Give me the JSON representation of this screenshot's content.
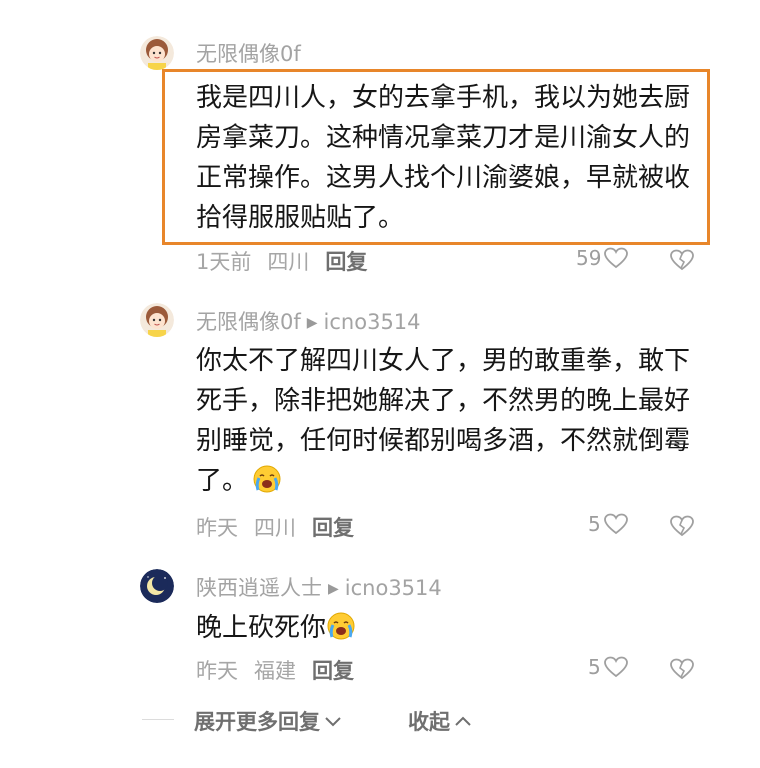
{
  "comments": [
    {
      "username": "无限偶像0f",
      "reply_to": "",
      "text": "我是四川人，女的去拿手机，我以为她去厨房拿菜刀。这种情况拿菜刀才是川渝女人的正常操作。这男人找个川渝婆娘，早就被收拾得服服贴贴了。",
      "time": "1天前",
      "location": "四川",
      "reply_label": "回复",
      "likes": "59",
      "avatar_icon": "cartoon-girl-avatar"
    },
    {
      "username": "无限偶像0f",
      "reply_to": "icno3514",
      "text": "你太不了解四川女人了，男的敢重拳，敢下死手，除非把她解决了，不然男的晚上最好别睡觉，任何时候都别喝多酒，不然就倒霉了。",
      "time": "昨天",
      "location": "四川",
      "reply_label": "回复",
      "likes": "5",
      "avatar_icon": "cartoon-girl-avatar"
    },
    {
      "username": "陕西逍遥人士",
      "reply_to": "icno3514",
      "text": "晚上砍死你",
      "time": "昨天",
      "location": "福建",
      "reply_label": "回复",
      "likes": "5",
      "avatar_icon": "crescent-moon-avatar"
    }
  ],
  "footer": {
    "expand_label": "展开更多回复",
    "collapse_label": "收起"
  },
  "colors": {
    "highlight_border": "#e8862a",
    "username": "#a3a3a3",
    "body_text": "#161616",
    "meta": "#a6a6a6"
  },
  "icons": {
    "reply_arrow": "play-triangle-icon",
    "like": "heart-icon",
    "dislike": "broken-heart-icon",
    "emoji": "crying-face-icon",
    "expand": "chevron-down-icon",
    "collapse": "chevron-up-icon"
  }
}
